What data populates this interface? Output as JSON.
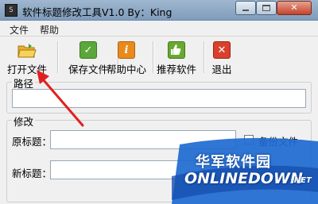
{
  "window": {
    "title": "软件标题修改工具V1.0 By：King",
    "app_icon_text": "S",
    "close_glyph": "✕"
  },
  "menu": {
    "items": [
      {
        "label": "文件"
      },
      {
        "label": "帮助"
      }
    ]
  },
  "toolbar": {
    "buttons": [
      {
        "label": "打开文件",
        "icon": "open-folder-icon",
        "color": "#e8b030"
      },
      {
        "label": "保存文件",
        "icon": "check-icon",
        "color": "#5aa83a",
        "glyph": "✓"
      },
      {
        "label": "帮助中心",
        "icon": "info-icon",
        "color": "#e98a1c",
        "glyph": "i"
      },
      {
        "label": "推荐软件",
        "icon": "thumbs-up-icon",
        "color": "#6aa832",
        "glyph": "👍"
      },
      {
        "label": "退出",
        "icon": "close-icon",
        "color": "#d9402b",
        "glyph": "✕"
      }
    ]
  },
  "path_group": {
    "title": "路径",
    "value": ""
  },
  "modify_group": {
    "title": "修改",
    "original_title_label": "原标题：",
    "original_title_value": "",
    "new_title_label": "新标题：",
    "new_title_value": "",
    "backup_label": "备份文件",
    "backup_checked": false
  },
  "watermark": {
    "top_text": "华军软件园",
    "bottom_text": "ONLINEDOWN",
    "suffix": ".NET"
  },
  "colors": {
    "titlebar": "#8eaac7",
    "annotation_arrow": "#e02020",
    "watermark_bg": "#1e6ad0"
  }
}
